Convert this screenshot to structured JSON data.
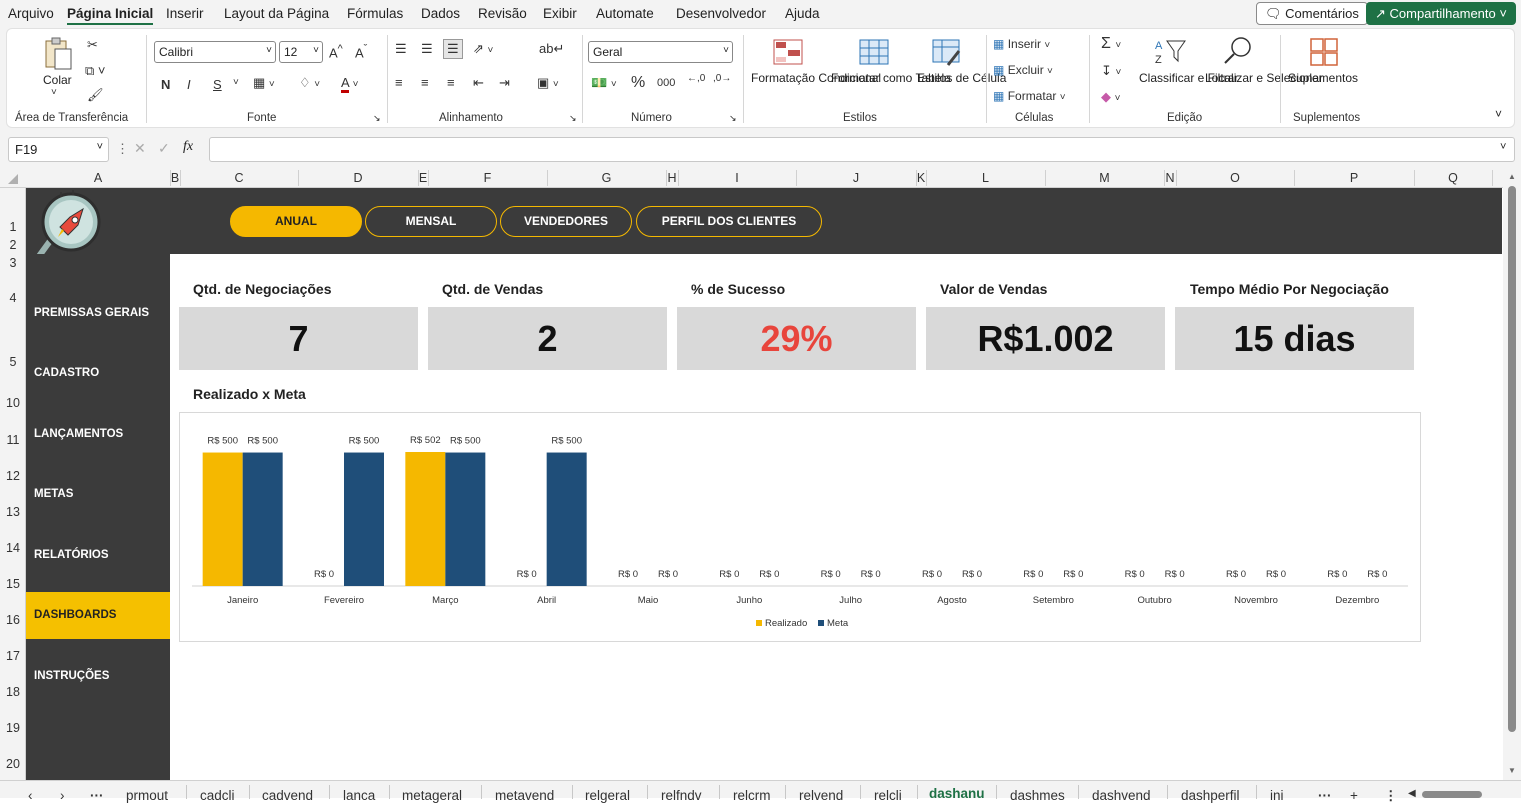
{
  "menu": {
    "items": [
      "Arquivo",
      "Página Inicial",
      "Inserir",
      "Layout da Página",
      "Fórmulas",
      "Dados",
      "Revisão",
      "Exibir",
      "Automate",
      "Desenvolvedor",
      "Ajuda"
    ],
    "comments_label": "Comentários",
    "share_label": "Compartilhamento"
  },
  "ribbon": {
    "clipboard": {
      "paste_label": "Colar",
      "group_label": "Área de Transferência"
    },
    "font": {
      "name": "Calibri",
      "size": "12",
      "bold": "N",
      "italic": "I",
      "underline": "S",
      "grow": "A^",
      "shrink": "Aˇ",
      "group_label": "Fonte"
    },
    "alignment": {
      "group_label": "Alinhamento"
    },
    "number": {
      "format": "Geral",
      "percent": "%",
      "thousands": "000",
      "group_label": "Número"
    },
    "styles": {
      "conditional": "Formatação Condicional",
      "table": "Formatar como Tabela",
      "cell_styles": "Estilos de Célula",
      "group_label": "Estilos"
    },
    "cells": {
      "insert": "Inserir",
      "delete": "Excluir",
      "format": "Formatar",
      "group_label": "Células"
    },
    "editing": {
      "sort": "Classificar e Filtrar",
      "find": "Localizar e Selecionar",
      "sum": "Σ",
      "group_label": "Edição"
    },
    "addins": {
      "label": "Suplementos",
      "group_label": "Suplementos"
    }
  },
  "formula_bar": {
    "name_box": "F19",
    "fx": "fx",
    "formula": ""
  },
  "columns": [
    "A",
    "B",
    "C",
    "D",
    "E",
    "F",
    "G",
    "H",
    "I",
    "J",
    "K",
    "L",
    "M",
    "N",
    "O",
    "P",
    "Q"
  ],
  "rows": [
    "1",
    "2",
    "3",
    "4",
    "5",
    "10",
    "11",
    "12",
    "13",
    "14",
    "15",
    "16",
    "17",
    "18",
    "19",
    "20"
  ],
  "nav": [
    "ANUAL",
    "MENSAL",
    "VENDEDORES",
    "PERFIL DOS CLIENTES"
  ],
  "sidebar": [
    "PREMISSAS GERAIS",
    "CADASTRO",
    "LANÇAMENTOS",
    "METAS",
    "RELATÓRIOS",
    "DASHBOARDS",
    "INSTRUÇÕES"
  ],
  "kpis": [
    {
      "title": "Qtd. de Negociações",
      "value": "7",
      "color": "#111111"
    },
    {
      "title": "Qtd. de Vendas",
      "value": "2",
      "color": "#111111"
    },
    {
      "title": "% de Sucesso",
      "value": "29%",
      "color": "#e8453c"
    },
    {
      "title": "Valor de Vendas",
      "value": "R$1.002",
      "color": "#111111"
    },
    {
      "title": "Tempo Médio Por Negociação",
      "value": "15 dias",
      "color": "#111111"
    }
  ],
  "chart_title": "Realizado x Meta",
  "chart_data": {
    "type": "bar",
    "categories": [
      "Janeiro",
      "Fevereiro",
      "Março",
      "Abril",
      "Maio",
      "Junho",
      "Julho",
      "Agosto",
      "Setembro",
      "Outubro",
      "Novembro",
      "Dezembro"
    ],
    "series": [
      {
        "name": "Realizado",
        "color": "#f5b800",
        "values": [
          500,
          0,
          502,
          0,
          0,
          0,
          0,
          0,
          0,
          0,
          0,
          0
        ],
        "labels": [
          "R$ 500",
          "R$ 0",
          "R$ 502",
          "R$ 0",
          "R$ 0",
          "R$ 0",
          "R$ 0",
          "R$ 0",
          "R$ 0",
          "R$ 0",
          "R$ 0",
          "R$ 0"
        ]
      },
      {
        "name": "Meta",
        "color": "#1f4e79",
        "values": [
          500,
          500,
          500,
          500,
          0,
          0,
          0,
          0,
          0,
          0,
          0,
          0
        ],
        "labels": [
          "R$ 500",
          "R$ 500",
          "R$ 500",
          "R$ 500",
          "R$ 0",
          "R$ 0",
          "R$ 0",
          "R$ 0",
          "R$ 0",
          "R$ 0",
          "R$ 0",
          "R$ 0"
        ]
      }
    ],
    "legend": "bottom",
    "grid": false
  },
  "sheet_tabs": [
    "prmout",
    "cadcli",
    "cadvend",
    "lanca",
    "metageral",
    "metavend",
    "relgeral",
    "relfndv",
    "relcrm",
    "relvend",
    "relcli",
    "dashanu",
    "dashmes",
    "dashvend",
    "dashperfil",
    "ini"
  ],
  "active_tab": "dashanu"
}
